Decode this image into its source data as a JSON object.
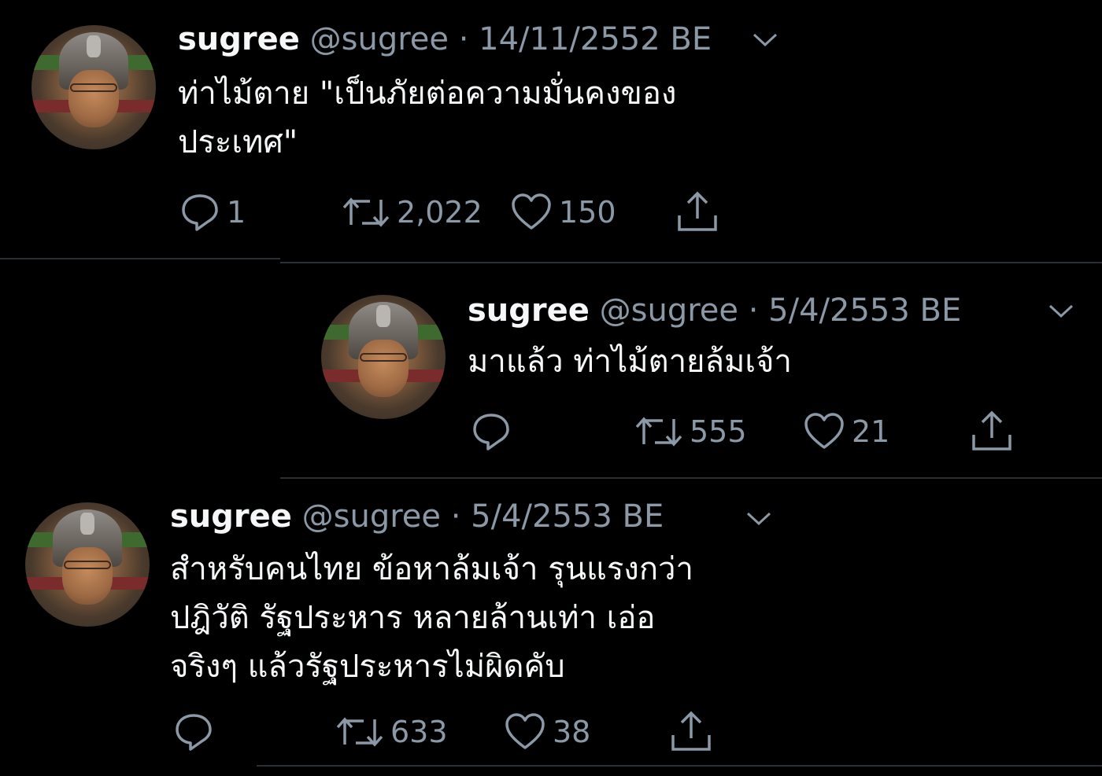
{
  "tweets": [
    {
      "name": "sugree",
      "handle": "@sugree",
      "date": "14/11/2552 BE",
      "text_lines": [
        "ท่าไม้ตาย \"เป็นภัยต่อความมั่นคงของ",
        "ประเทศ\""
      ],
      "replies": "1",
      "retweets": "2,022",
      "likes": "150"
    },
    {
      "name": "sugree",
      "handle": "@sugree",
      "date": "5/4/2553 BE",
      "text_lines": [
        "มาแล้ว ท่าไม้ตายล้มเจ้า"
      ],
      "replies": "",
      "retweets": "555",
      "likes": "21"
    },
    {
      "name": "sugree",
      "handle": "@sugree",
      "date": "5/4/2553 BE",
      "text_lines": [
        "สำหรับคนไทย ข้อหาล้มเจ้า รุนแรงกว่า",
        "ปฎิวัติ รัฐประหาร หลายล้านเท่า เอ่อ",
        "จริงๆ แล้วรัฐประหารไม่ผิดคับ"
      ],
      "replies": "",
      "retweets": "633",
      "likes": "38"
    }
  ],
  "separator": "·",
  "icons": [
    "avatar-photo",
    "chevron-down-icon",
    "reply-icon",
    "retweet-icon",
    "like-icon",
    "share-icon"
  ]
}
